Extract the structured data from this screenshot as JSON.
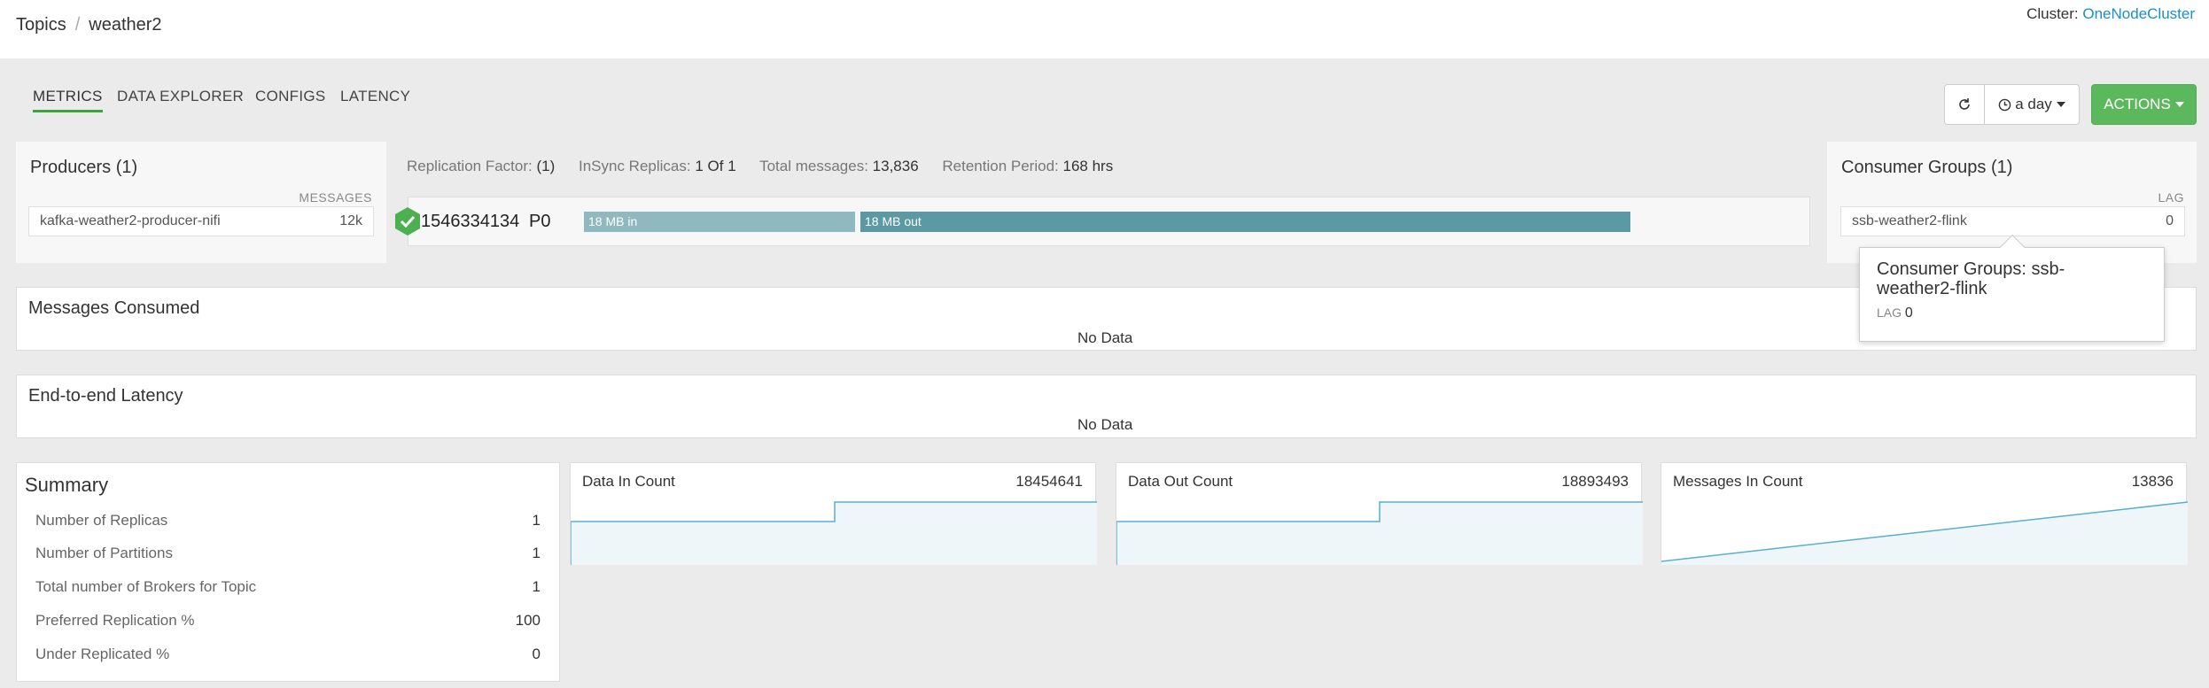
{
  "breadcrumb": {
    "root": "Topics",
    "current": "weather2"
  },
  "cluster": {
    "label": "Cluster:",
    "name": "OneNodeCluster"
  },
  "tabs": [
    {
      "label": "METRICS",
      "active": true
    },
    {
      "label": "DATA EXPLORER"
    },
    {
      "label": "CONFIGS"
    },
    {
      "label": "LATENCY"
    }
  ],
  "toolbar": {
    "range_label": "a day",
    "actions_label": "ACTIONS"
  },
  "producers": {
    "title": "Producers (1)",
    "col_header": "MESSAGES",
    "items": [
      {
        "name": "kafka-weather2-producer-nifi",
        "value": "12k"
      }
    ]
  },
  "replication": {
    "factor_label": "Replication Factor:",
    "factor_value": "(1)",
    "insync_label": "InSync Replicas:",
    "insync_value": "1 Of 1",
    "total_label": "Total messages:",
    "total_value": "13,836",
    "retention_label": "Retention Period:",
    "retention_value": "168 hrs"
  },
  "partition": {
    "broker_id": "1546334134",
    "partition": "P0",
    "in_label": "18 MB in",
    "out_label": "18 MB out"
  },
  "consumers": {
    "title": "Consumer Groups (1)",
    "col_header": "LAG",
    "items": [
      {
        "name": "ssb-weather2-flink",
        "value": "0"
      }
    ]
  },
  "tooltip": {
    "title": "Consumer Groups: ssb-weather2-flink",
    "lag_label": "LAG",
    "lag_value": "0"
  },
  "messages_consumed": {
    "title": "Messages Consumed",
    "empty": "No Data"
  },
  "e2e_latency": {
    "title": "End-to-end Latency",
    "empty": "No Data"
  },
  "summary": {
    "title": "Summary",
    "rows": [
      {
        "label": "Number of Replicas",
        "value": "1"
      },
      {
        "label": "Number of Partitions",
        "value": "1"
      },
      {
        "label": "Total number of Brokers for Topic",
        "value": "1"
      },
      {
        "label": "Preferred Replication %",
        "value": "100"
      },
      {
        "label": "Under Replicated %",
        "value": "0"
      }
    ]
  },
  "sparklines": [
    {
      "label": "Data In Count",
      "value": "18454641"
    },
    {
      "label": "Data Out Count",
      "value": "18893493"
    },
    {
      "label": "Messages In Count",
      "value": "13836"
    }
  ],
  "colors": {
    "accent_green": "#5cb85c",
    "link_blue": "#1a8fc9",
    "bar_in": "#8fb8bf",
    "bar_out": "#5b9aa4",
    "spark_line": "#5aaed0",
    "spark_fill": "#eef6fa"
  }
}
